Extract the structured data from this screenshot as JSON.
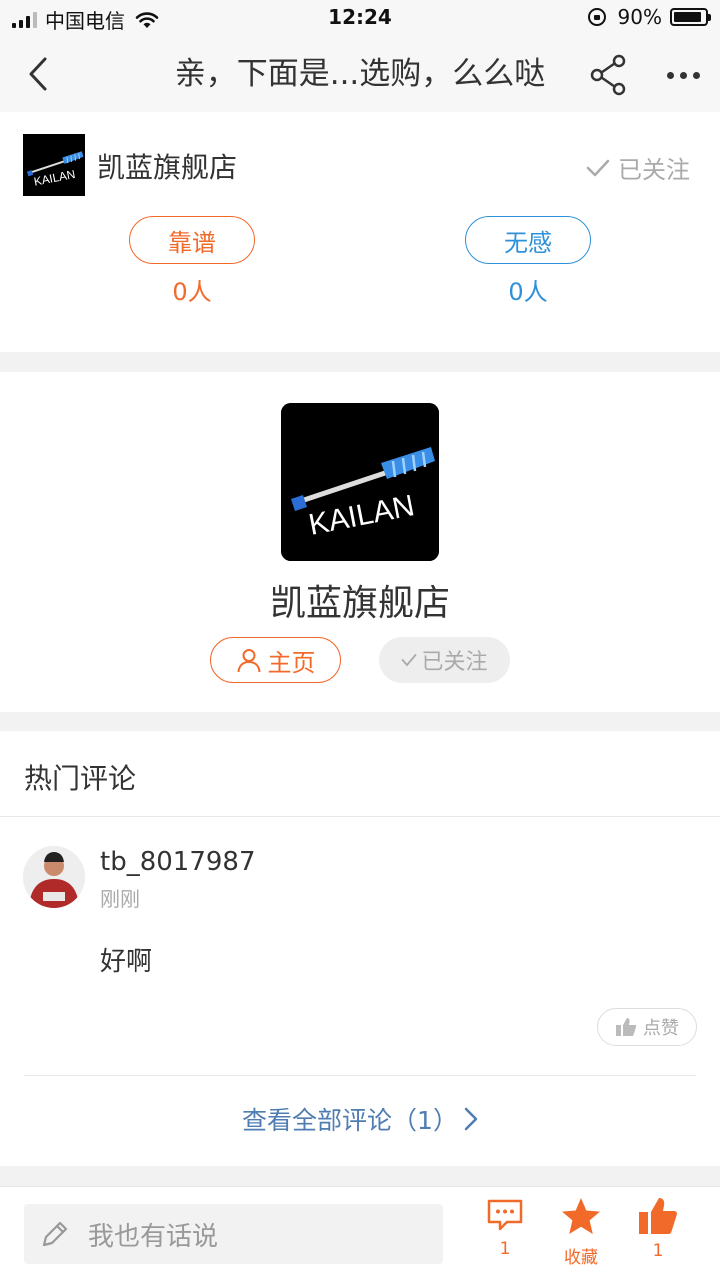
{
  "status_bar": {
    "carrier": "中国电信",
    "time": "12:24",
    "battery": "90%",
    "battery_level": 0.9
  },
  "nav": {
    "title": "亲，下面是...选购，么么哒"
  },
  "store_header": {
    "name": "凯蓝旗舰店",
    "follow_status": "已关注",
    "reliable_label": "靠谱",
    "reliable_count": "0人",
    "meh_label": "无感",
    "meh_count": "0人"
  },
  "store_profile": {
    "logo_text": "KAILAN",
    "name": "凯蓝旗舰店",
    "home_label": "主页",
    "following_label": "已关注"
  },
  "comments": {
    "section_title": "热门评论",
    "items": [
      {
        "user": "tb_8017987",
        "time": "刚刚",
        "text": "好啊",
        "like_label": "点赞"
      }
    ],
    "view_all": "查看全部评论（1）"
  },
  "bottom_bar": {
    "input_placeholder": "我也有话说",
    "comment_count": "1",
    "favorite_label": "收藏",
    "like_count": "1"
  },
  "colors": {
    "accent_orange": "#f26a2a",
    "accent_blue": "#2f92d8",
    "link_blue": "#4f7db2"
  }
}
